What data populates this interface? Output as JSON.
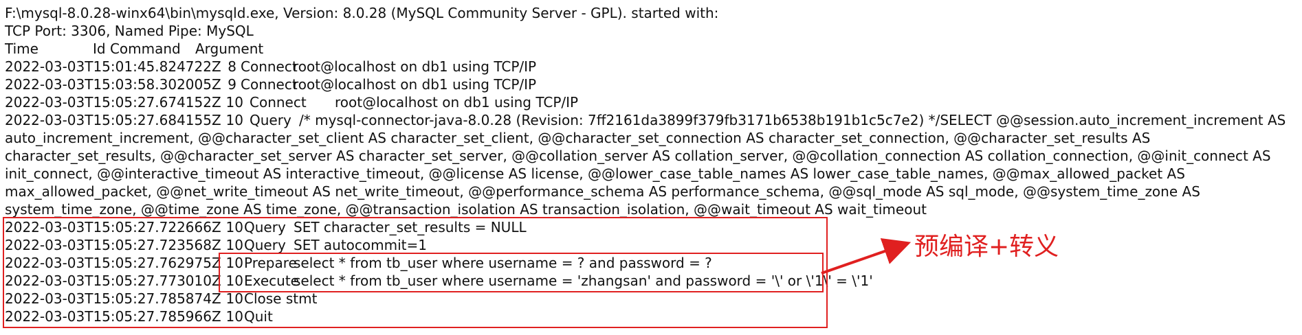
{
  "header": {
    "line1": "F:\\mysql-8.0.28-winx64\\bin\\mysqld.exe, Version: 8.0.28 (MySQL Community Server - GPL). started with:",
    "line2": "TCP Port: 3306, Named Pipe: MySQL",
    "col_time": "Time",
    "col_id_command": "Id Command",
    "col_argument": "Argument"
  },
  "entries": [
    {
      "time": "2022-03-03T15:01:45.824722Z",
      "id": "8",
      "command": "Connect",
      "argument": "root@localhost on db1 using TCP/IP"
    },
    {
      "time": "2022-03-03T15:03:58.302005Z",
      "id": "9",
      "command": "Connect",
      "argument": "root@localhost on db1 using TCP/IP"
    },
    {
      "time": "2022-03-03T15:05:27.674152Z",
      "id": "10",
      "command": "Connect",
      "argument": "root@localhost on db1 using TCP/IP"
    },
    {
      "time": "2022-03-03T15:05:27.684155Z",
      "id": "10",
      "command": "Query",
      "argument": "/* mysql-connector-java-8.0.28 (Revision: 7ff2161da3899f379fb3171b6538b191b1c5c7e2) */SELECT  @@session.auto_increment_increment AS auto_increment_increment, @@character_set_client AS character_set_client, @@character_set_connection AS character_set_connection, @@character_set_results AS character_set_results, @@character_set_server AS character_set_server, @@collation_server AS collation_server, @@collation_connection AS collation_connection, @@init_connect AS init_connect, @@interactive_timeout AS interactive_timeout, @@license AS license, @@lower_case_table_names AS lower_case_table_names, @@max_allowed_packet AS max_allowed_packet, @@net_write_timeout AS net_write_timeout, @@performance_schema AS performance_schema, @@sql_mode AS sql_mode, @@system_time_zone AS system_time_zone, @@time_zone AS time_zone, @@transaction_isolation AS transaction_isolation, @@wait_timeout AS wait_timeout"
    },
    {
      "time": "2022-03-03T15:05:27.722666Z",
      "id": "10",
      "command": "Query",
      "argument": "SET character_set_results = NULL"
    },
    {
      "time": "2022-03-03T15:05:27.723568Z",
      "id": "10",
      "command": "Query",
      "argument": "SET autocommit=1"
    },
    {
      "time": "2022-03-03T15:05:27.762975Z",
      "id": "10",
      "command": "Prepare",
      "argument": "select * from tb_user where username = ? and password = ?"
    },
    {
      "time": "2022-03-03T15:05:27.773010Z",
      "id": "10",
      "command": "Execute",
      "argument": "select * from tb_user where username = 'zhangsan' and password = '\\' or \\'1\\' = \\'1'"
    },
    {
      "time": "2022-03-03T15:05:27.785874Z",
      "id": "10",
      "command": "Close stmt",
      "argument": ""
    },
    {
      "time": "2022-03-03T15:05:27.785966Z",
      "id": "10",
      "command": "Quit",
      "argument": ""
    }
  ],
  "annotation": {
    "label": "预编译+转义",
    "color": "#e02020"
  }
}
